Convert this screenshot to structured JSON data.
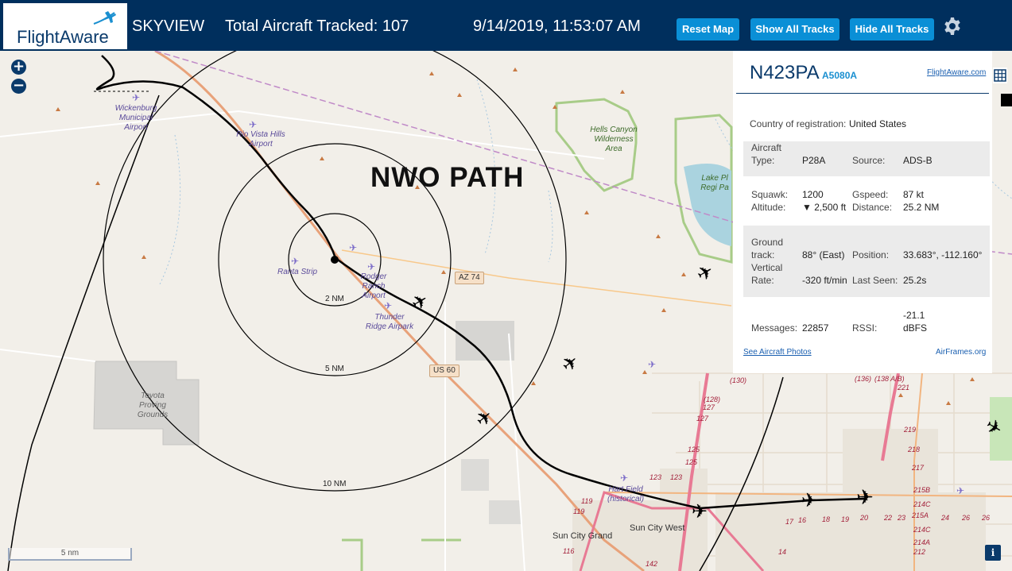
{
  "header": {
    "logo_text": "FlightAware",
    "app_name": "SKYVIEW",
    "total_tracked": "Total Aircraft Tracked: 107",
    "datetime": "9/14/2019, 11:53:07 AM",
    "reset_label": "Reset Map",
    "show_label": "Show All Tracks",
    "hide_label": "Hide All Tracks",
    "settings_icon": "gear-icon",
    "colors": {
      "bar": "#002f5d",
      "button": "#0a8fd6"
    }
  },
  "map": {
    "zoom_in": "+",
    "zoom_out": "−",
    "overlay_title": "NWO PATH",
    "rings": [
      "2 NM",
      "5 NM",
      "10 NM"
    ],
    "roads": [
      "AZ 74",
      "US 60"
    ],
    "airports": [
      "Wickenburg Municipal Airport",
      "Rio Vista Hills Airport",
      "Ranta Strip",
      "Rodger Ranch Airport",
      "Thunder Ridge Airpark",
      "Hart Field (historical)"
    ],
    "places": [
      "Toyota Proving Grounds",
      "Sun City Grand",
      "Sun City West"
    ],
    "green_areas": [
      "Hells Canyon Wilderness Area",
      "Lake Pl Regi Pa"
    ],
    "exits": [
      "(130)",
      "(128)",
      "127",
      "127",
      "125",
      "125",
      "123",
      "123",
      "119",
      "119",
      "116",
      "(136)",
      "(138 A/B)",
      "221",
      "219",
      "218",
      "217",
      "215B",
      "215A",
      "214C",
      "214C",
      "214A",
      "212",
      "17",
      "16",
      "18",
      "19",
      "20",
      "22",
      "23",
      "24",
      "26",
      "26",
      "14",
      "142"
    ],
    "scale_label": "5 nm",
    "info_icon": "i"
  },
  "panel": {
    "callsign": "N423PA",
    "hex": "A5080A",
    "link": "FlightAware.com",
    "country_label": "Country of registration:",
    "country": "United States",
    "aircraft_type_label": "Aircraft Type:",
    "aircraft_type": "P28A",
    "source_label": "Source:",
    "source": "ADS-B",
    "squawk_label": "Squawk:",
    "squawk": "1200",
    "gspeed_label": "Gspeed:",
    "gspeed": "87 kt",
    "altitude_label": "Altitude:",
    "altitude": "▼ 2,500 ft",
    "distance_label": "Distance:",
    "distance": "25.2 NM",
    "ground_track_label": "Ground track:",
    "ground_track": "88° (East)",
    "position_label": "Position:",
    "position": "33.683°, -112.160°",
    "vertical_rate_label": "Vertical Rate:",
    "vertical_rate": "-320 ft/min",
    "last_seen_label": "Last Seen:",
    "last_seen": "25.2s",
    "messages_label": "Messages:",
    "messages": "22857",
    "rssi_label": "RSSI:",
    "rssi": "-21.1 dBFS",
    "photos_link": "See Aircraft Photos",
    "airframes_link": "AirFrames.org"
  }
}
